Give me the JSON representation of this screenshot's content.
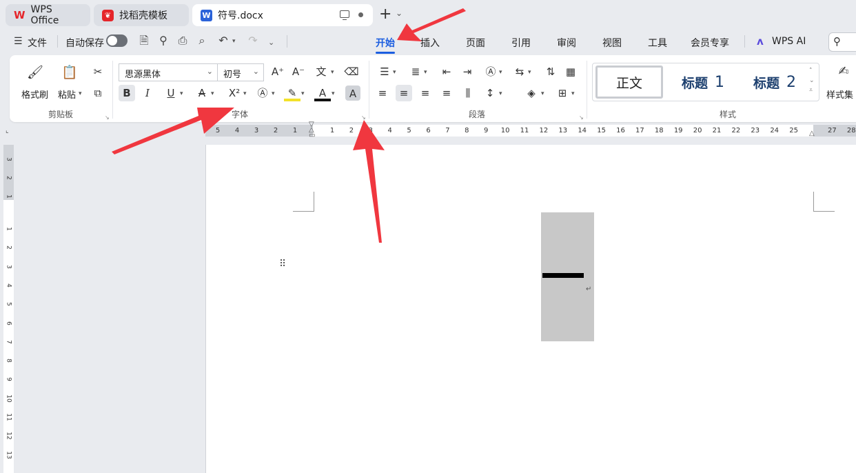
{
  "tabs": {
    "wps_home": "WPS Office",
    "template": "找稻壳模板",
    "document": "符号.docx",
    "new_tab": "+"
  },
  "menu": {
    "file": "文件",
    "autosave": "自动保存",
    "items": [
      "开始",
      "插入",
      "页面",
      "引用",
      "审阅",
      "视图",
      "工具",
      "会员专享"
    ],
    "active": "开始",
    "wps_ai": "WPS AI"
  },
  "ribbon": {
    "clipboard": {
      "format_painter": "格式刷",
      "paste": "粘贴",
      "group_label": "剪贴板"
    },
    "font": {
      "font_name": "思源黑体",
      "font_size": "初号",
      "bold": "B",
      "italic": "I",
      "underline": "U",
      "superscript": "X²",
      "group_label": "字体"
    },
    "paragraph": {
      "group_label": "段落"
    },
    "styles": {
      "normal": "正文",
      "heading1": "标题",
      "heading1_num": "1",
      "heading2": "标题",
      "heading2_num": "2",
      "style_set": "样式集",
      "group_label": "样式"
    }
  },
  "ruler": {
    "horizontal_left": [
      "5",
      "4",
      "3",
      "2",
      "1"
    ],
    "horizontal_right": [
      "1",
      "2",
      "3",
      "4",
      "5",
      "6",
      "7",
      "8",
      "9",
      "10",
      "11",
      "12",
      "13",
      "14",
      "15",
      "16",
      "17",
      "18",
      "19",
      "20",
      "21",
      "22",
      "23",
      "24",
      "25",
      "27",
      "28"
    ],
    "vertical_top": [
      "3",
      "2",
      "1"
    ],
    "vertical_bottom": [
      "1",
      "2",
      "3",
      "4",
      "5",
      "6",
      "7",
      "8",
      "9",
      "10",
      "11",
      "12",
      "13"
    ]
  },
  "colors": {
    "accent": "#1a5de0",
    "arrow": "#f0373f",
    "selection": "#c8c8c8",
    "wps_red": "#e5252a",
    "word_blue": "#2b63d9"
  }
}
